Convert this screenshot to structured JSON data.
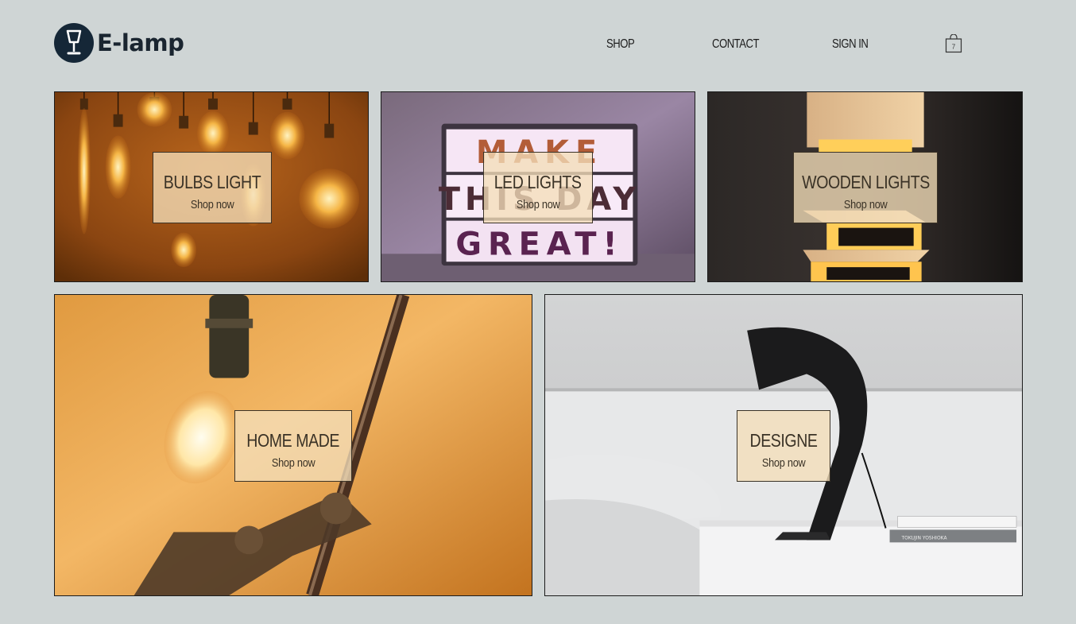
{
  "header": {
    "logo_text": "E-lamp",
    "nav": {
      "shop": "SHOP",
      "contact": "CONTACT",
      "sign_in": "SIGN IN"
    },
    "cart_count": "7"
  },
  "tiles": [
    {
      "title": "BULBS LIGHT",
      "cta": "Shop now"
    },
    {
      "title": "LED LIGHTS",
      "cta": "Shop now",
      "lightbox_words": [
        "MAKE",
        "THIS DAY",
        "GREAT!"
      ]
    },
    {
      "title": "WOODEN LIGHTS",
      "cta": "Shop now"
    },
    {
      "title": "HOME MADE",
      "cta": "Shop now"
    },
    {
      "title": "DESIGNE",
      "cta": "Shop now",
      "book_spine": "TOKUJIN YOSHIOKA"
    }
  ],
  "colors": {
    "background": "#cfd5d5",
    "logo": "#152737",
    "overlay": "#f3deb8"
  }
}
